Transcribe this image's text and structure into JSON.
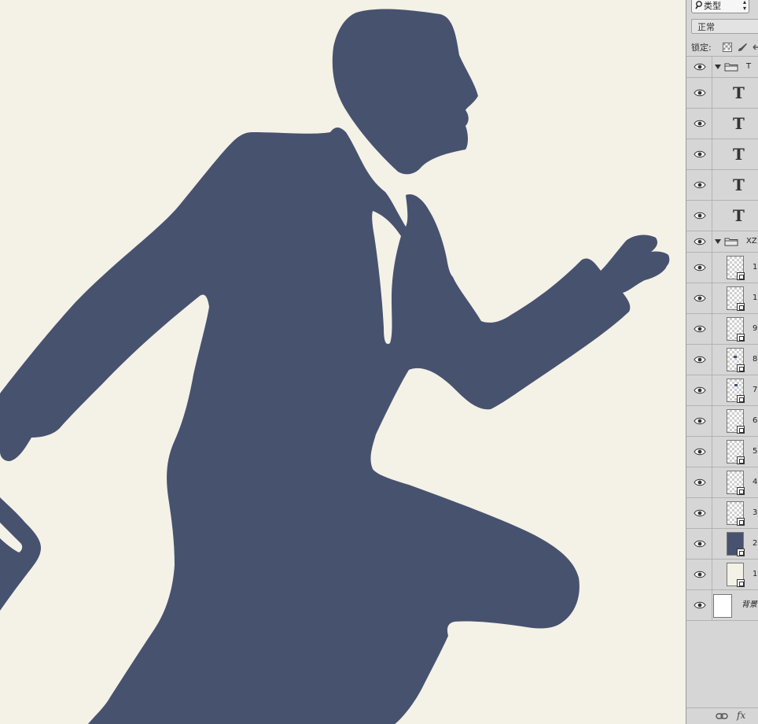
{
  "colors": {
    "canvas_bg": "#f4f1e7",
    "figure": "#47526f",
    "panel_bg": "#d6d6d6"
  },
  "layers_panel": {
    "filter_label": "类型",
    "blend_mode": "正常",
    "lock_label": "锁定:",
    "groups": [
      {
        "name": "T",
        "layers": [
          {
            "type": "text",
            "glyph": "T"
          },
          {
            "type": "text",
            "glyph": "T"
          },
          {
            "type": "text",
            "glyph": "T"
          },
          {
            "type": "text",
            "glyph": "T"
          },
          {
            "type": "text",
            "glyph": "T"
          }
        ]
      },
      {
        "name": "XZ",
        "layers": [
          {
            "type": "smart",
            "name": "1"
          },
          {
            "type": "smart",
            "name": "1"
          },
          {
            "type": "smart",
            "name": "9"
          },
          {
            "type": "smart",
            "name": "8"
          },
          {
            "type": "smart",
            "name": "7"
          },
          {
            "type": "smart",
            "name": "6"
          },
          {
            "type": "smart",
            "name": "5"
          },
          {
            "type": "smart",
            "name": "4"
          },
          {
            "type": "smart",
            "name": "3"
          },
          {
            "type": "smart",
            "name": "2"
          },
          {
            "type": "smart",
            "name": "1"
          }
        ]
      }
    ],
    "background_layer": "背景",
    "footer": {
      "link": "⊖⊖",
      "fx": "fx"
    }
  }
}
